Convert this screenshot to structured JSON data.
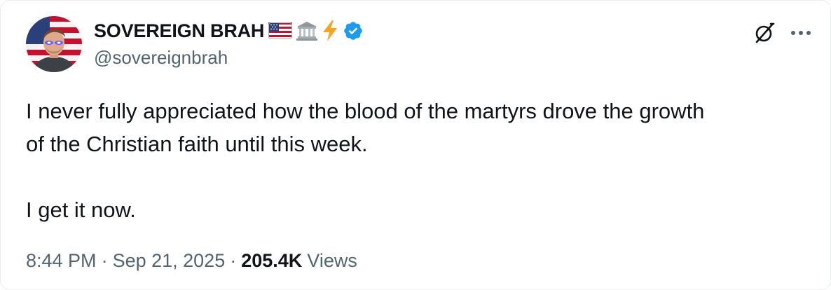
{
  "author": {
    "display_name": "SOVEREIGN BRAH",
    "name_emojis": [
      "us-flag-emoji",
      "classical-building-emoji",
      "high-voltage-emoji"
    ],
    "verified": true,
    "handle": "@sovereignbrah"
  },
  "tweet": {
    "text": "I never fully appreciated how the blood of the martyrs drove the growth\nof the Christian faith until this week.\n\nI get it now."
  },
  "meta": {
    "time": "8:44 PM",
    "separator": "·",
    "date": "Sep 21, 2025",
    "views_count": "205.4K",
    "views_label": "Views"
  },
  "actions": {
    "grok_icon": "grok-icon",
    "more_icon": "more-icon"
  },
  "colors": {
    "text_primary": "#0f1419",
    "text_secondary": "#536471",
    "verified_blue": "#1d9bf0",
    "border": "#e6ecf0"
  }
}
